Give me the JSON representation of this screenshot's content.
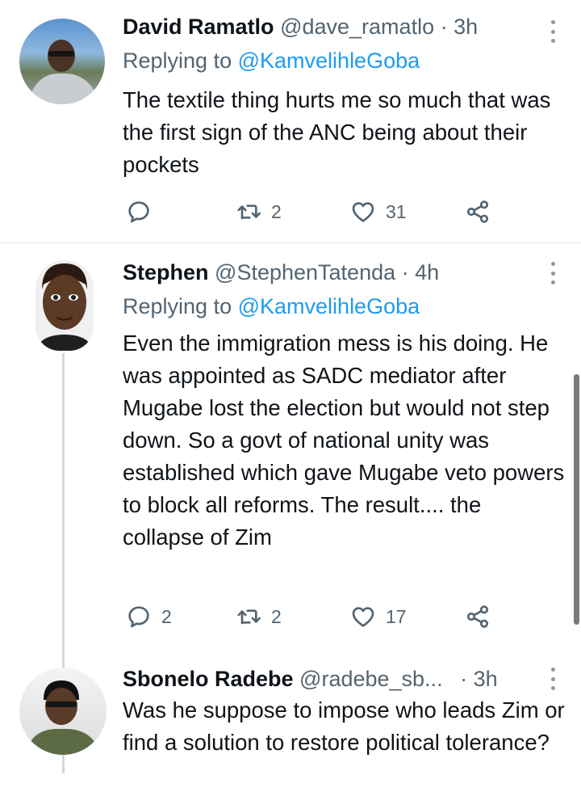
{
  "tweets": [
    {
      "display_name": "David Ramatlo",
      "handle": "@dave_ramatlo",
      "sep": "·",
      "time": "3h",
      "replying_label": "Replying to",
      "replying_to": "@KamvelihleGoba",
      "text": "The textile thing hurts me so much that was the first sign of the ANC being about their pockets",
      "reply_count": "",
      "retweet_count": "2",
      "like_count": "31"
    },
    {
      "display_name": "Stephen",
      "handle": "@StephenTatenda",
      "sep": "·",
      "time": "4h",
      "replying_label": "Replying to",
      "replying_to": "@KamvelihleGoba",
      "text": "Even the immigration mess is his doing. He was appointed as SADC mediator after Mugabe lost the election but would not step down. So a govt of national unity was established which gave Mugabe veto powers to block all reforms. The result.... the collapse of Zim",
      "reply_count": "2",
      "retweet_count": "2",
      "like_count": "17"
    },
    {
      "display_name": "Sbonelo Radebe",
      "handle": "@radebe_sb...",
      "sep": "·",
      "time": "3h",
      "text": "Was he suppose to impose who leads Zim or find a solution to restore political tolerance?"
    }
  ],
  "icons": [
    "reply-icon",
    "retweet-icon",
    "like-icon",
    "share-icon",
    "more-options-icon"
  ],
  "colors": {
    "text": "#0f1419",
    "secondary": "#536471",
    "mention": "#1d9bf0",
    "divider": "#e1e4e8"
  }
}
